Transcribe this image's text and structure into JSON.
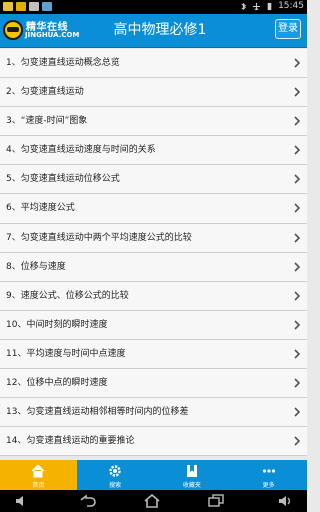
{
  "status_bar": {
    "time": "15:45"
  },
  "header": {
    "brand": "精华在线",
    "domain": "JINGHUA.COM",
    "title": "高中物理必修1",
    "login_label": "登录"
  },
  "items": [
    {
      "label": "1、匀变速直线运动概念总览"
    },
    {
      "label": "2、匀变速直线运动"
    },
    {
      "label": "3、“速度-时间”图象"
    },
    {
      "label": "4、匀变速直线运动速度与时间的关系"
    },
    {
      "label": "5、匀变速直线运动位移公式"
    },
    {
      "label": "6、平均速度公式"
    },
    {
      "label": "7、匀变速直线运动中两个平均速度公式的比较"
    },
    {
      "label": "8、位移与速度"
    },
    {
      "label": "9、速度公式、位移公式的比较"
    },
    {
      "label": "10、中间时刻的瞬时速度"
    },
    {
      "label": "11、平均速度与时间中点速度"
    },
    {
      "label": "12、位移中点的瞬时速度"
    },
    {
      "label": "13、匀变速直线运动相邻相等时间内的位移差"
    },
    {
      "label": "14、匀变速直线运动的重要推论"
    }
  ],
  "tabs": [
    {
      "label": "首页",
      "icon": "home-icon",
      "active": true
    },
    {
      "label": "搜索",
      "icon": "gear-icon",
      "active": false
    },
    {
      "label": "收藏夹",
      "icon": "bookmark-icon",
      "active": false
    },
    {
      "label": "更多",
      "icon": "more-icon",
      "active": false
    }
  ],
  "colors": {
    "accent": "#0a8fd7",
    "active_tab": "#f5b300",
    "list_bg": "#f7f7f7"
  }
}
